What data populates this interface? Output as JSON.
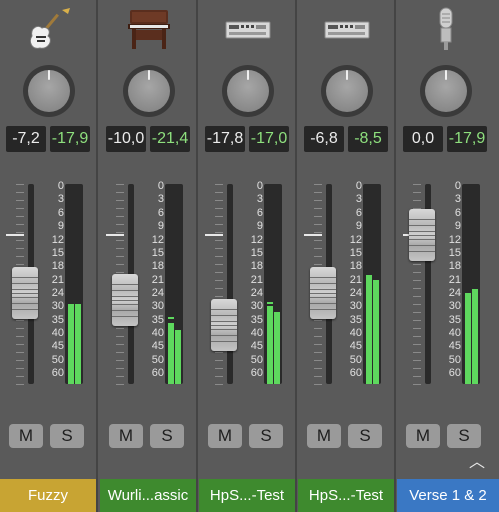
{
  "strips": [
    {
      "name": "Fuzzy",
      "icon": "electric-guitar-icon",
      "volume": "-7,2",
      "peak": "-17,9",
      "mute": "M",
      "solo": "S",
      "color": "#c8a433",
      "fader_db": -24,
      "meter_l_db": -29,
      "meter_r_db": -29,
      "meter_peak_l_db": null,
      "meter_peak_r_db": null
    },
    {
      "name": "Wurli...assic",
      "icon": "electric-piano-icon",
      "volume": "-10,0",
      "peak": "-21,4",
      "mute": "M",
      "solo": "S",
      "color": "#3e8a2e",
      "fader_db": -27,
      "meter_l_db": -36,
      "meter_r_db": -39,
      "meter_peak_l_db": -34,
      "meter_peak_r_db": null
    },
    {
      "name": "HpS...-Test",
      "icon": "synth-module-icon",
      "volume": "-17,8",
      "peak": "-17,0",
      "mute": "M",
      "solo": "S",
      "color": "#3e8a2e",
      "fader_db": -37,
      "meter_l_db": -30,
      "meter_r_db": -32,
      "meter_peak_l_db": -28,
      "meter_peak_r_db": null
    },
    {
      "name": "HpS...-Test",
      "icon": "synth-module-icon",
      "volume": "-6,8",
      "peak": "-8,5",
      "mute": "M",
      "solo": "S",
      "color": "#3e8a2e",
      "fader_db": -24,
      "meter_l_db": -20,
      "meter_r_db": -21,
      "meter_peak_l_db": null,
      "meter_peak_r_db": null
    },
    {
      "name": "Verse 1 & 2",
      "icon": "condenser-microphone-icon",
      "volume": "0,0",
      "peak": "-17,9",
      "mute": "M",
      "solo": "S",
      "color": "#3a78c4",
      "fader_db": -11,
      "meter_l_db": -24,
      "meter_r_db": -23,
      "meter_peak_l_db": null,
      "meter_peak_r_db": null
    }
  ],
  "db_scale": [
    "0",
    "3",
    "6",
    "9",
    "12",
    "15",
    "18",
    "21",
    "24",
    "30",
    "35",
    "40",
    "45",
    "50",
    "60"
  ],
  "collapse_icon": "chevron-up-icon",
  "collapse_glyph": "︿"
}
